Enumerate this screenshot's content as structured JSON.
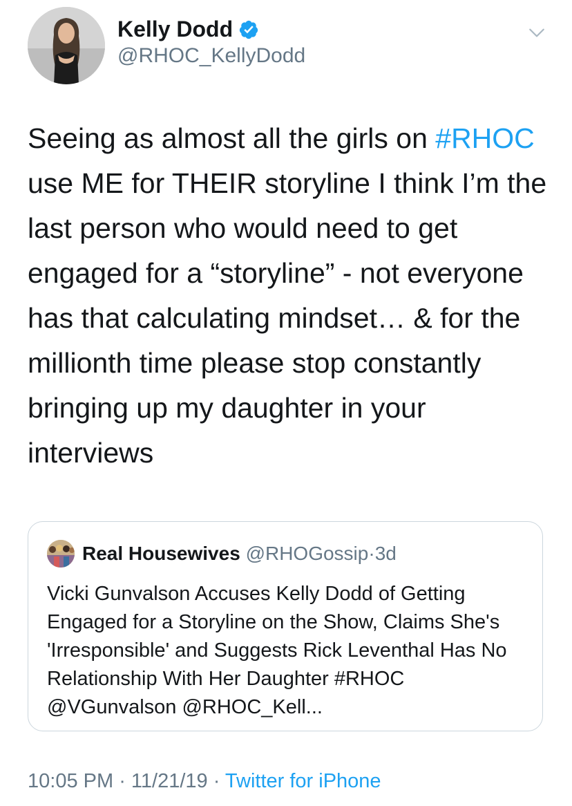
{
  "author": {
    "display_name": "Kelly Dodd",
    "handle": "@RHOC_KellyDodd",
    "verified": true,
    "avatar_icon": "profile-photo"
  },
  "tweet": {
    "text_before": "Seeing as almost all the girls on ",
    "hashtag": "#RHOC",
    "text_after": " use ME for THEIR storyline I think I’m the last person who would need to get engaged for a “storyline” - not everyone has that calculating mindset… & for the millionth time please stop constantly bringing up my daughter in your interviews"
  },
  "quoted_tweet": {
    "display_name": "Real Housewives",
    "handle": "@RHOGossip",
    "separator": "·",
    "age": "3d",
    "text": "Vicki Gunvalson Accuses Kelly Dodd of Getting Engaged for a Storyline on the Show, Claims She's 'Irresponsible' and Suggests Rick Leventhal Has No Relationship With Her Daughter #RHOC @VGunvalson @RHOC_Kell..."
  },
  "footer": {
    "time": "10:05 PM",
    "separator1": " · ",
    "date": "11/21/19",
    "separator2": " · ",
    "source": "Twitter for iPhone"
  },
  "colors": {
    "link": "#1da1f2",
    "secondary_text": "#657786",
    "border": "#ccd6dd"
  }
}
